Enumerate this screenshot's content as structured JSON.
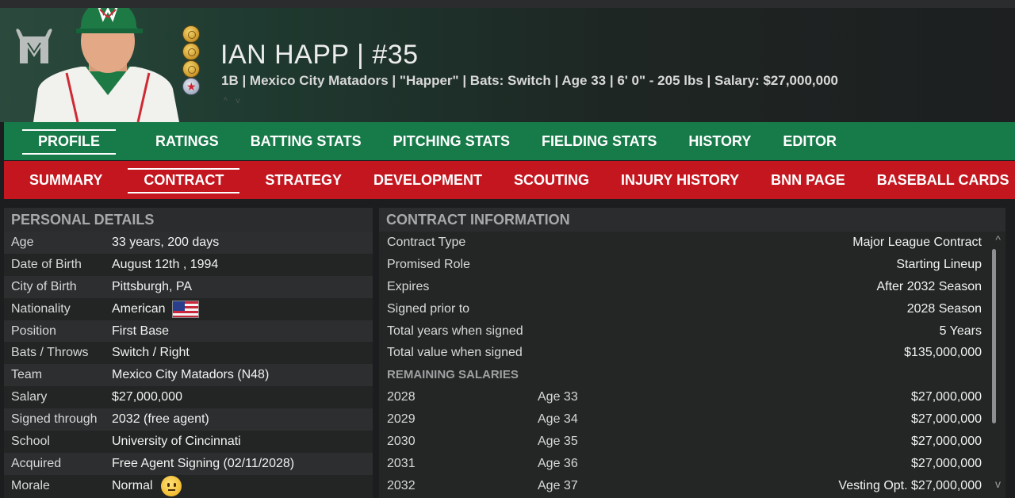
{
  "header": {
    "name": "IAN HAPP  |  #35",
    "info": "1B | Mexico City Matadors  |  \"Happer\" | Bats: Switch  |  Age 33  |  6' 0\"  - 205 lbs  |  Salary: $27,000,000"
  },
  "nav_main": [
    "PROFILE",
    "RATINGS",
    "BATTING STATS",
    "PITCHING STATS",
    "FIELDING STATS",
    "HISTORY",
    "EDITOR"
  ],
  "nav_sub": [
    "SUMMARY",
    "CONTRACT",
    "STRATEGY",
    "DEVELOPMENT",
    "SCOUTING",
    "INJURY HISTORY",
    "BNN PAGE",
    "BASEBALL CARDS"
  ],
  "personal": {
    "title": "PERSONAL DETAILS",
    "rows": [
      {
        "k": "Age",
        "v": "33 years, 200 days"
      },
      {
        "k": "Date of Birth",
        "v": "August 12th , 1994"
      },
      {
        "k": "City of Birth",
        "v": "Pittsburgh, PA"
      },
      {
        "k": "Nationality",
        "v": "American"
      },
      {
        "k": "Position",
        "v": "First Base"
      },
      {
        "k": "Bats / Throws",
        "v": "Switch / Right"
      },
      {
        "k": "Team",
        "v": "Mexico City Matadors (N48)"
      },
      {
        "k": "Salary",
        "v": "$27,000,000"
      },
      {
        "k": "Signed through",
        "v": "2032 (free agent)"
      },
      {
        "k": "School",
        "v": "University of Cincinnati"
      },
      {
        "k": "Acquired",
        "v": "Free Agent Signing (02/11/2028)"
      },
      {
        "k": "Morale",
        "v": "Normal"
      }
    ]
  },
  "contract": {
    "title": "CONTRACT INFORMATION",
    "rows": [
      {
        "k": "Contract Type",
        "v": "Major League Contract"
      },
      {
        "k": "Promised Role",
        "v": "Starting Lineup"
      },
      {
        "k": "Expires",
        "v": "After 2032 Season"
      },
      {
        "k": "Signed prior to",
        "v": "2028 Season"
      },
      {
        "k": "Total years when signed",
        "v": "5 Years"
      },
      {
        "k": "Total value when signed",
        "v": "$135,000,000"
      }
    ],
    "remaining_title": "REMAINING SALARIES",
    "salaries": [
      {
        "year": "2028",
        "age": "Age 33",
        "amount": "$27,000,000"
      },
      {
        "year": "2029",
        "age": "Age 34",
        "amount": "$27,000,000"
      },
      {
        "year": "2030",
        "age": "Age 35",
        "amount": "$27,000,000"
      },
      {
        "year": "2031",
        "age": "Age 36",
        "amount": "$27,000,000"
      },
      {
        "year": "2032",
        "age": "Age 37",
        "amount": "Vesting Opt. $27,000,000"
      }
    ]
  },
  "icons": {
    "team_logo": "bull-m-logo-icon",
    "medal": "medal-icon",
    "flag": "us-flag-icon",
    "morale": "neutral-face-icon"
  },
  "colors": {
    "nav_main": "#177a49",
    "nav_sub": "#c3161f",
    "panel": "#242626"
  }
}
